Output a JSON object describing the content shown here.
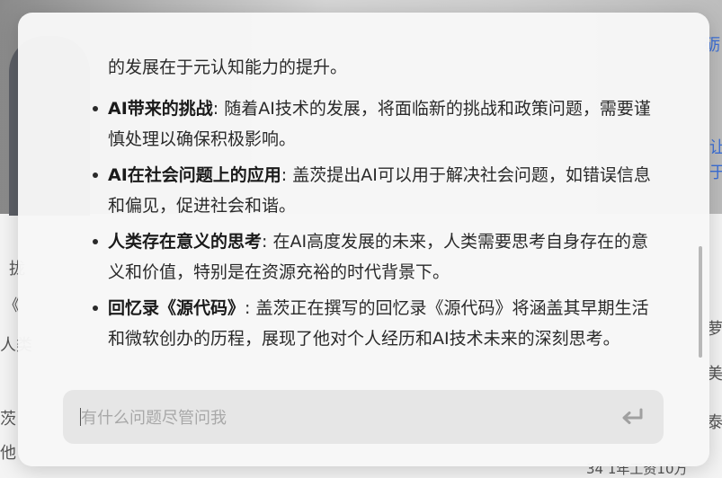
{
  "background": {
    "right_top": "砺",
    "right_mid_1": "让",
    "right_mid_2": "于",
    "left_1": "拢",
    "left_2": "《",
    "left_3": "人类",
    "left_4": "茨",
    "left_5": "他",
    "right_low_1": "萝",
    "right_low_2": "美",
    "right_low_3": "泰",
    "bottom_right": "34 1年工资10万"
  },
  "answer": {
    "lead": "的发展在于元认知能力的提升。",
    "points": [
      {
        "title": "AI带来的挑战",
        "text": ": 随着AI技术的发展，将面临新的挑战和政策问题，需要谨慎处理以确保积极影响。"
      },
      {
        "title": "AI在社会问题上的应用",
        "text": ": 盖茨提出AI可以用于解决社会问题，如错误信息和偏见，促进社会和谐。"
      },
      {
        "title": "人类存在意义的思考",
        "text": ": 在AI高度发展的未来，人类需要思考自身存在的意义和价值，特别是在资源充裕的时代背景下。"
      },
      {
        "title": "回忆录《源代码》",
        "text": ": 盖茨正在撰写的回忆录《源代码》将涵盖其早期生活和微软创办的历程，展现了他对个人经历和AI技术未来的深刻思考。"
      }
    ]
  },
  "input": {
    "placeholder": "有什么问题尽管问我",
    "value": ""
  },
  "icons": {
    "submit": "enter-return-icon"
  },
  "colors": {
    "dialog_bg": "#f7f7f7",
    "input_bg": "#e6e6e6",
    "text": "#2a2a2a",
    "placeholder": "#a8a8a8"
  }
}
